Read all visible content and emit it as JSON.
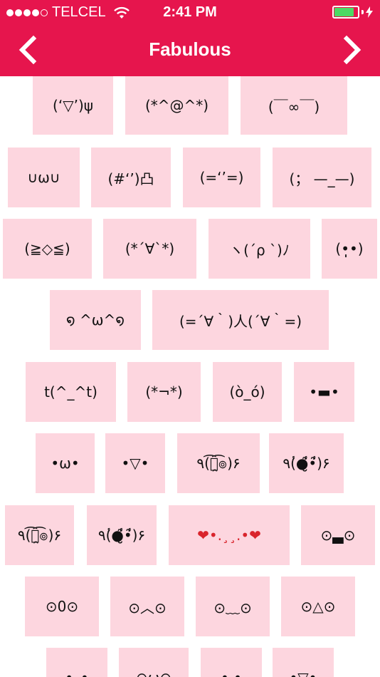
{
  "status_bar": {
    "carrier": "TELCEL",
    "time": "2:41 PM",
    "signal_bars_filled": 4,
    "signal_bars_total": 5,
    "battery_level": 0.9,
    "battery_color": "#4cd964"
  },
  "nav": {
    "title": "Fabulous",
    "back_icon": "chevron-left-icon",
    "forward_icon": "chevron-right-icon",
    "bar_color": "#e6154d"
  },
  "tile_color": "#fdd6df",
  "emoticons": [
    [
      "(‘▽’)ψ",
      "(*^@^*)",
      "(￣∞￣)"
    ],
    [
      "∪ω∪",
      "(#‘’)凸",
      "(=‘’=)",
      "(； —_—)"
    ],
    [
      "(≧◇≦)",
      "(*´∀`*)",
      "ヽ(´ρ `)ﾉ",
      "(•̩̩̩̩•)"
    ],
    [
      "໑ ^ω^໑",
      "(=´∀｀)人(´∀｀=)"
    ],
    [
      "t(^_^t)",
      "(*¬*)",
      "(ò_ó)",
      "•▬•"
    ],
    [
      "•ω•",
      "•▽•",
      "٩(͡๏̯͡๏)۶",
      "٩(̾●̮̮̃̾•̃̾)۶"
    ],
    [
      "٩(͡๏̯͡๏)۶",
      "٩(̾●̮̮̃̾•̃̾)۶",
      "❤•.¸¸.•❤",
      "⊙▃⊙"
    ],
    [
      "⊙0⊙",
      "⊙︿⊙",
      "⊙﹏⊙",
      "⊙△⊙"
    ],
    [
      "•_•",
      "⊙ω⊙",
      "•.•",
      "•▽•"
    ]
  ]
}
